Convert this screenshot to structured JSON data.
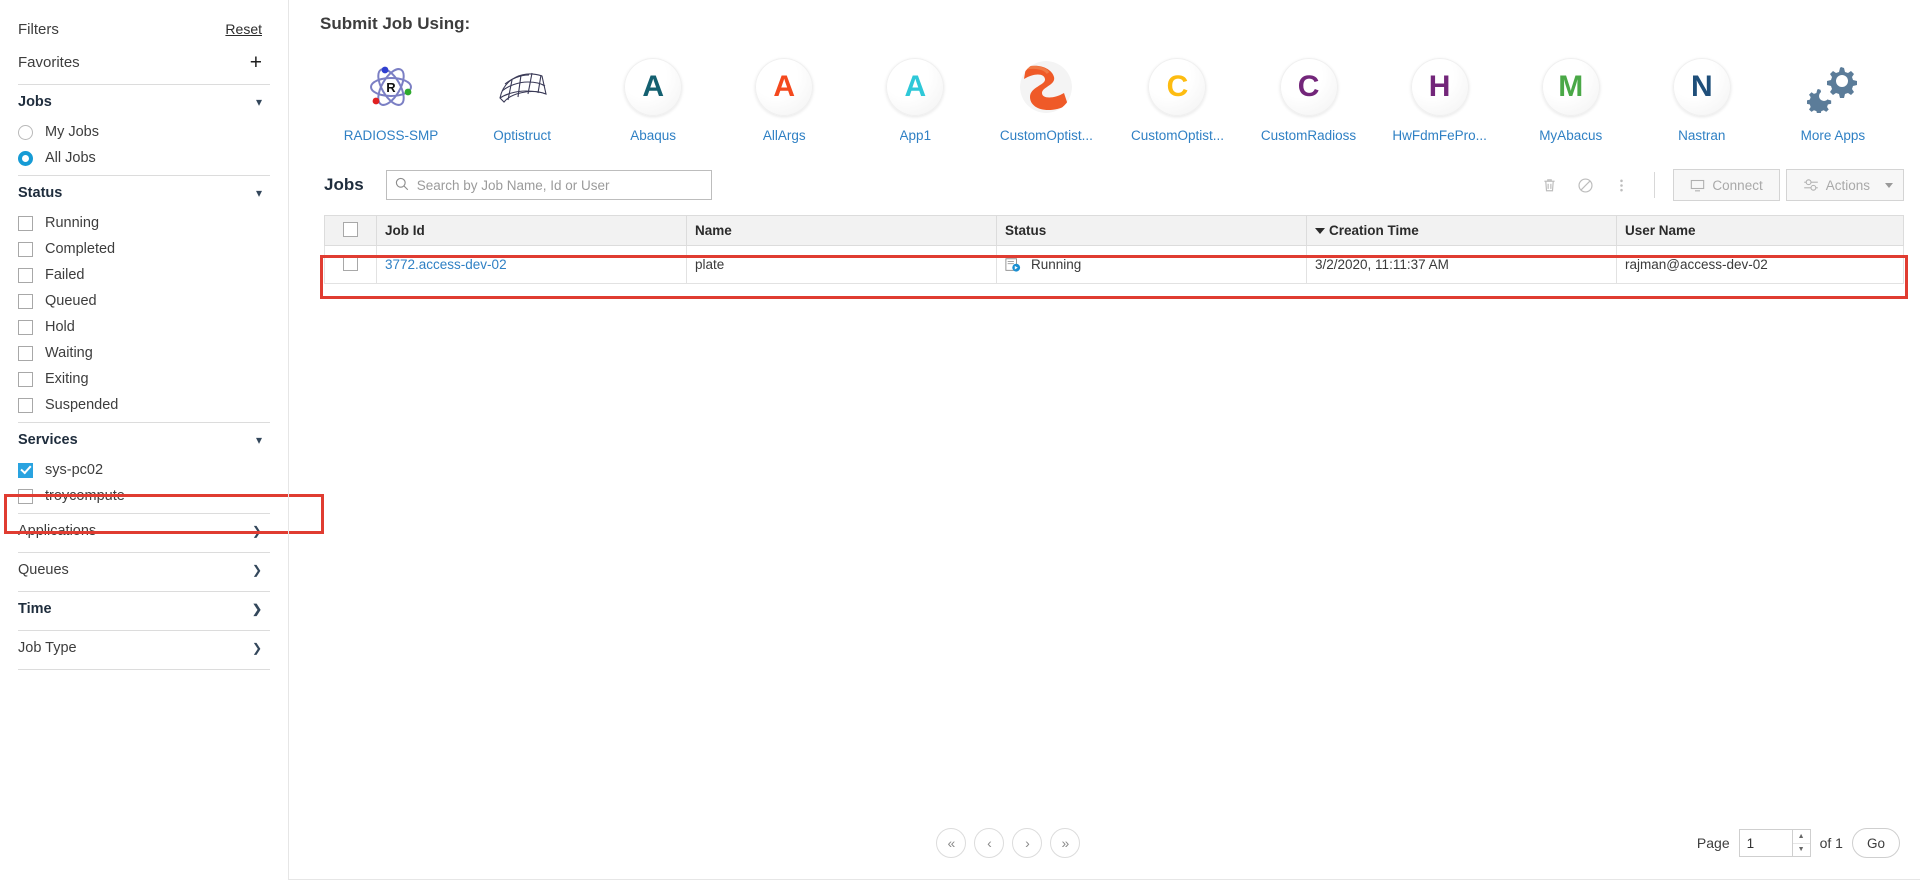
{
  "sidebar": {
    "filters_label": "Filters",
    "reset_label": "Reset",
    "favorites_label": "Favorites",
    "add_icon": "+",
    "jobs": {
      "title": "Jobs",
      "options": [
        {
          "label": "My Jobs",
          "selected": false
        },
        {
          "label": "All Jobs",
          "selected": true
        }
      ]
    },
    "status": {
      "title": "Status",
      "options": [
        {
          "label": "Running",
          "checked": false
        },
        {
          "label": "Completed",
          "checked": false
        },
        {
          "label": "Failed",
          "checked": false
        },
        {
          "label": "Queued",
          "checked": false
        },
        {
          "label": "Hold",
          "checked": false
        },
        {
          "label": "Waiting",
          "checked": false
        },
        {
          "label": "Exiting",
          "checked": false
        },
        {
          "label": "Suspended",
          "checked": false
        }
      ]
    },
    "services": {
      "title": "Services",
      "options": [
        {
          "label": "sys-pc02",
          "checked": true
        },
        {
          "label": "troycompute",
          "checked": false
        }
      ]
    },
    "sections": [
      {
        "label": "Applications",
        "bold": false
      },
      {
        "label": "Queues",
        "bold": false
      },
      {
        "label": "Time",
        "bold": true
      },
      {
        "label": "Job Type",
        "bold": false
      }
    ]
  },
  "main": {
    "submit_title": "Submit Job Using:",
    "apps": [
      {
        "label": "RADIOSS-SMP",
        "icon": "atom-r-icon",
        "glyph": "",
        "color": "#7b7fc4"
      },
      {
        "label": "Optistruct",
        "icon": "mesh-icon",
        "glyph": "",
        "color": "#33334d"
      },
      {
        "label": "Abaqus",
        "icon": "letter-a-icon",
        "glyph": "A",
        "color": "#146070"
      },
      {
        "label": "AllArgs",
        "icon": "letter-a-icon",
        "glyph": "A",
        "color": "#f4491e"
      },
      {
        "label": "App1",
        "icon": "letter-a-icon",
        "glyph": "A",
        "color": "#2ec8d8"
      },
      {
        "label": "CustomOptist...",
        "icon": "altair-swoosh-icon",
        "glyph": "",
        "color": "#ee5b26"
      },
      {
        "label": "CustomOptist...",
        "icon": "letter-c-icon",
        "glyph": "C",
        "color": "#fdbc11"
      },
      {
        "label": "CustomRadioss",
        "icon": "letter-c-icon",
        "glyph": "C",
        "color": "#73267a"
      },
      {
        "label": "HwFdmFePro...",
        "icon": "letter-h-icon",
        "glyph": "H",
        "color": "#73267a"
      },
      {
        "label": "MyAbacus",
        "icon": "letter-m-icon",
        "glyph": "M",
        "color": "#4aa847"
      },
      {
        "label": "Nastran",
        "icon": "letter-n-icon",
        "glyph": "N",
        "color": "#1f4f7a"
      },
      {
        "label": "More Apps",
        "icon": "gears-icon",
        "glyph": "",
        "color": "#5b7c99"
      }
    ],
    "jobs_title": "Jobs",
    "search_placeholder": "Search by Job Name, Id or User",
    "search_value": "",
    "toolbar": {
      "delete_icon": "trash-icon",
      "cancel_icon": "ban-icon",
      "more_icon": "kebab-menu-icon",
      "connect_label": "Connect",
      "actions_label": "Actions"
    },
    "table": {
      "columns": [
        "Job Id",
        "Name",
        "Status",
        "Creation Time",
        "User Name"
      ],
      "sorted_column": "Creation Time",
      "sort_direction": "desc",
      "rows": [
        {
          "checked": false,
          "job_id": "3772.access-dev-02",
          "name": "plate",
          "status": "Running",
          "creation_time": "3/2/2020, 11:11:37 AM",
          "user_name": "rajman@access-dev-02",
          "highlighted": true
        }
      ]
    },
    "pagination": {
      "first_label": "«",
      "prev_label": "‹",
      "next_label": "›",
      "last_label": "»",
      "page_label": "Page",
      "page_value": "1",
      "of_label": "of 1",
      "go_label": "Go"
    }
  },
  "colors": {
    "accent": "#2f80c4",
    "highlight": "#e03c31",
    "checkbox_on": "#29a3e0"
  }
}
